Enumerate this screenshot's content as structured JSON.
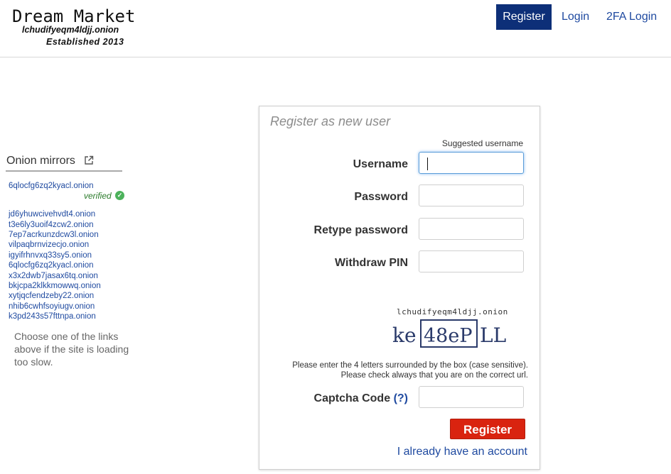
{
  "header": {
    "logo_title": "Dream Market",
    "logo_onion": "lchudifyeqm4ldjj.onion",
    "logo_established": "Established 2013",
    "nav": {
      "register": "Register",
      "login": "Login",
      "twofa_login": "2FA Login"
    }
  },
  "sidebar": {
    "title": "Onion mirrors",
    "verified_mirror": "6qlocfg6zq2kyacl.onion",
    "verified_label": "verified",
    "mirrors": [
      "jd6yhuwcivehvdt4.onion",
      "t3e6ly3uoif4zcw2.onion",
      "7ep7acrkunzdcw3l.onion",
      "vilpaqbrnvizecjo.onion",
      "igyifrhnvxq33sy5.onion",
      "6qlocfg6zq2kyacl.onion",
      "x3x2dwb7jasax6tq.onion",
      "bkjcpa2klkkmowwq.onion",
      "xytjqcfendzeby22.onion",
      "nhib6cwhfsoyiugv.onion",
      "k3pd243s57fttnpa.onion"
    ],
    "help_text": "Choose one of the links above if the site is loading too slow."
  },
  "form": {
    "title": "Register as new user",
    "suggested_username": "Suggested username",
    "username_label": "Username",
    "username_value": "",
    "password_label": "Password",
    "retype_label": "Retype password",
    "pin_label": "Withdraw PIN",
    "captcha_url": "lchudifyeqm4ldjj.onion",
    "captcha_left": "ke",
    "captcha_box": "48eP",
    "captcha_right": "LL",
    "captcha_note_1": "Please enter the 4 letters surrounded by the box (case sensitive).",
    "captcha_note_2": "Please check always that you are on the correct url.",
    "captcha_label": "Captcha Code",
    "captcha_help": "(?)",
    "submit_label": "Register",
    "account_link": "I already have an account"
  },
  "colors": {
    "nav_active_bg": "#0d2f78",
    "link": "#1f4aa0",
    "submit_bg": "#d9230f",
    "verified": "#4cb25b"
  }
}
